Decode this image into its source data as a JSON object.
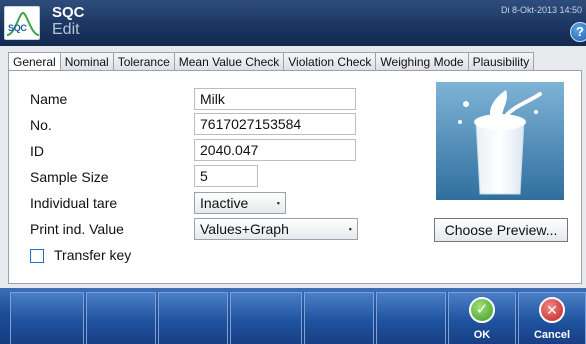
{
  "header": {
    "logo_text": "SQC",
    "title": "SQC",
    "subtitle": "Edit",
    "datetime": "Di 8-Okt-2013 14:50",
    "help_icon": "question-icon"
  },
  "tabs": [
    {
      "label": "General",
      "active": true
    },
    {
      "label": "Nominal"
    },
    {
      "label": "Tolerance"
    },
    {
      "label": "Mean Value Check"
    },
    {
      "label": "Violation Check"
    },
    {
      "label": "Weighing Mode"
    },
    {
      "label": "Plausibility"
    }
  ],
  "form": {
    "name_label": "Name",
    "name_value": "Milk",
    "no_label": "No.",
    "no_value": "7617027153584",
    "id_label": "ID",
    "id_value": "2040.047",
    "sample_size_label": "Sample Size",
    "sample_size_value": "5",
    "individual_tare_label": "Individual tare",
    "individual_tare_value": "Inactive",
    "print_label": "Print ind. Value",
    "print_value": "Values+Graph",
    "transfer_key_label": "Transfer key",
    "transfer_key_checked": false
  },
  "preview": {
    "choose_label": "Choose Preview...",
    "image_subject": "milk-glass-image"
  },
  "bottom": {
    "ok_label": "OK",
    "cancel_label": "Cancel",
    "accent": "#1d4d97"
  }
}
